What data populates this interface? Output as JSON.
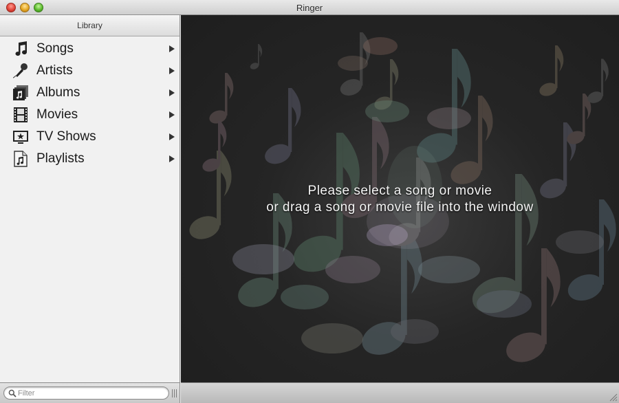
{
  "window": {
    "title": "Ringer"
  },
  "sidebar": {
    "header": "Library",
    "items": [
      {
        "label": "Songs",
        "icon": "music-note-icon"
      },
      {
        "label": "Artists",
        "icon": "microphone-icon"
      },
      {
        "label": "Albums",
        "icon": "albums-icon"
      },
      {
        "label": "Movies",
        "icon": "film-strip-icon"
      },
      {
        "label": "TV Shows",
        "icon": "tv-icon"
      },
      {
        "label": "Playlists",
        "icon": "playlist-icon"
      }
    ]
  },
  "main": {
    "message_line1": "Please select a song or movie",
    "message_line2": "or drag a song or movie file into the window"
  },
  "footer": {
    "filter_placeholder": "Filter"
  },
  "colors": {
    "sidebar_bg": "#f1f1f1",
    "content_bg": "#252525",
    "message_text": "#f5f5f5"
  }
}
